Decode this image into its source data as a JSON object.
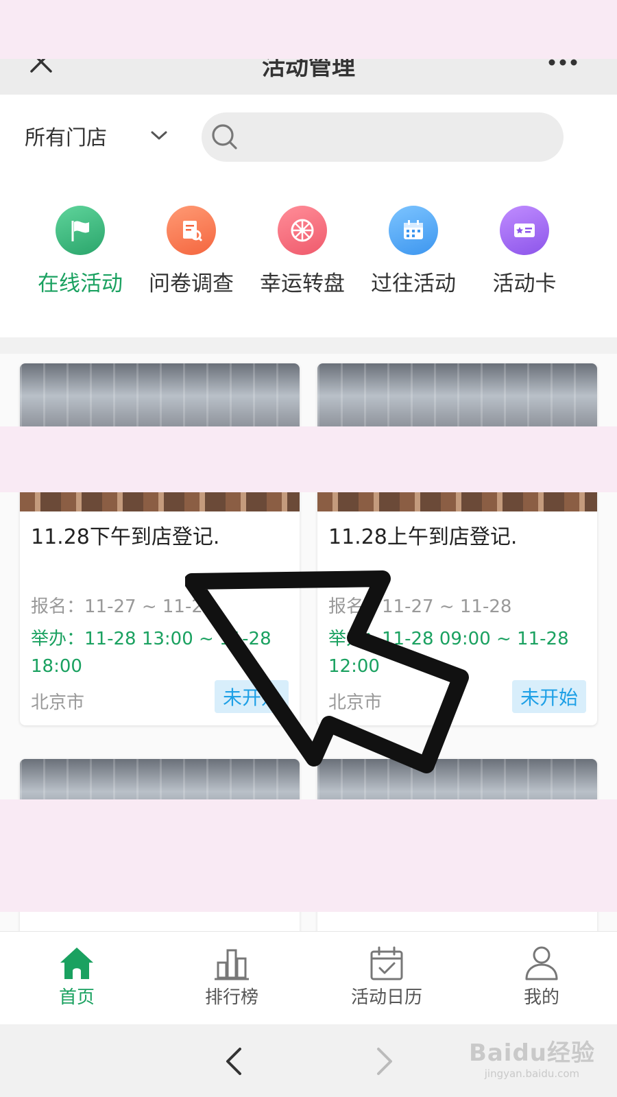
{
  "header": {
    "title": "活动管理",
    "close_icon": "close-icon",
    "more_icon": "more-icon"
  },
  "filter": {
    "store_label": "所有门店",
    "search_placeholder": ""
  },
  "quick_nav": [
    {
      "label": "在线活动",
      "icon": "flag-icon",
      "color": "#37b97a",
      "active": true
    },
    {
      "label": "问卷调查",
      "icon": "survey-icon",
      "color": "#f8795a",
      "active": false
    },
    {
      "label": "幸运转盘",
      "icon": "wheel-icon",
      "color": "#f46e7d",
      "active": false
    },
    {
      "label": "过往活动",
      "icon": "calendar-icon",
      "color": "#52aaf3",
      "active": false
    },
    {
      "label": "活动卡",
      "icon": "card-icon",
      "color": "#a46cf0",
      "active": false
    }
  ],
  "cards": [
    {
      "title": "11.28下午到店登记.",
      "registration": "报名：11-27 ~ 11-28",
      "hold": "举办：11-28 13:00 ~ 11-28 18:00",
      "city": "北京市",
      "status": "未开始"
    },
    {
      "title": "11.28上午到店登记.",
      "registration": "报名：11-27 ~ 11-28",
      "hold": "举办：11-28 09:00 ~ 11-28 12:00",
      "city": "北京市",
      "status": "未开始"
    }
  ],
  "tabbar": [
    {
      "label": "首页",
      "icon": "home-icon",
      "active": true
    },
    {
      "label": "排行榜",
      "icon": "ranking-icon",
      "active": false
    },
    {
      "label": "活动日历",
      "icon": "calendar-check-icon",
      "active": false
    },
    {
      "label": "我的",
      "icon": "user-icon",
      "active": false
    }
  ],
  "colors": {
    "accent": "#1aa160",
    "badge_bg": "#d8eefb",
    "badge_text": "#1ea0e6",
    "censor": "#f9eaf4"
  },
  "watermark": {
    "line1": "Baidu经验",
    "line2": "jingyan.baidu.com"
  }
}
